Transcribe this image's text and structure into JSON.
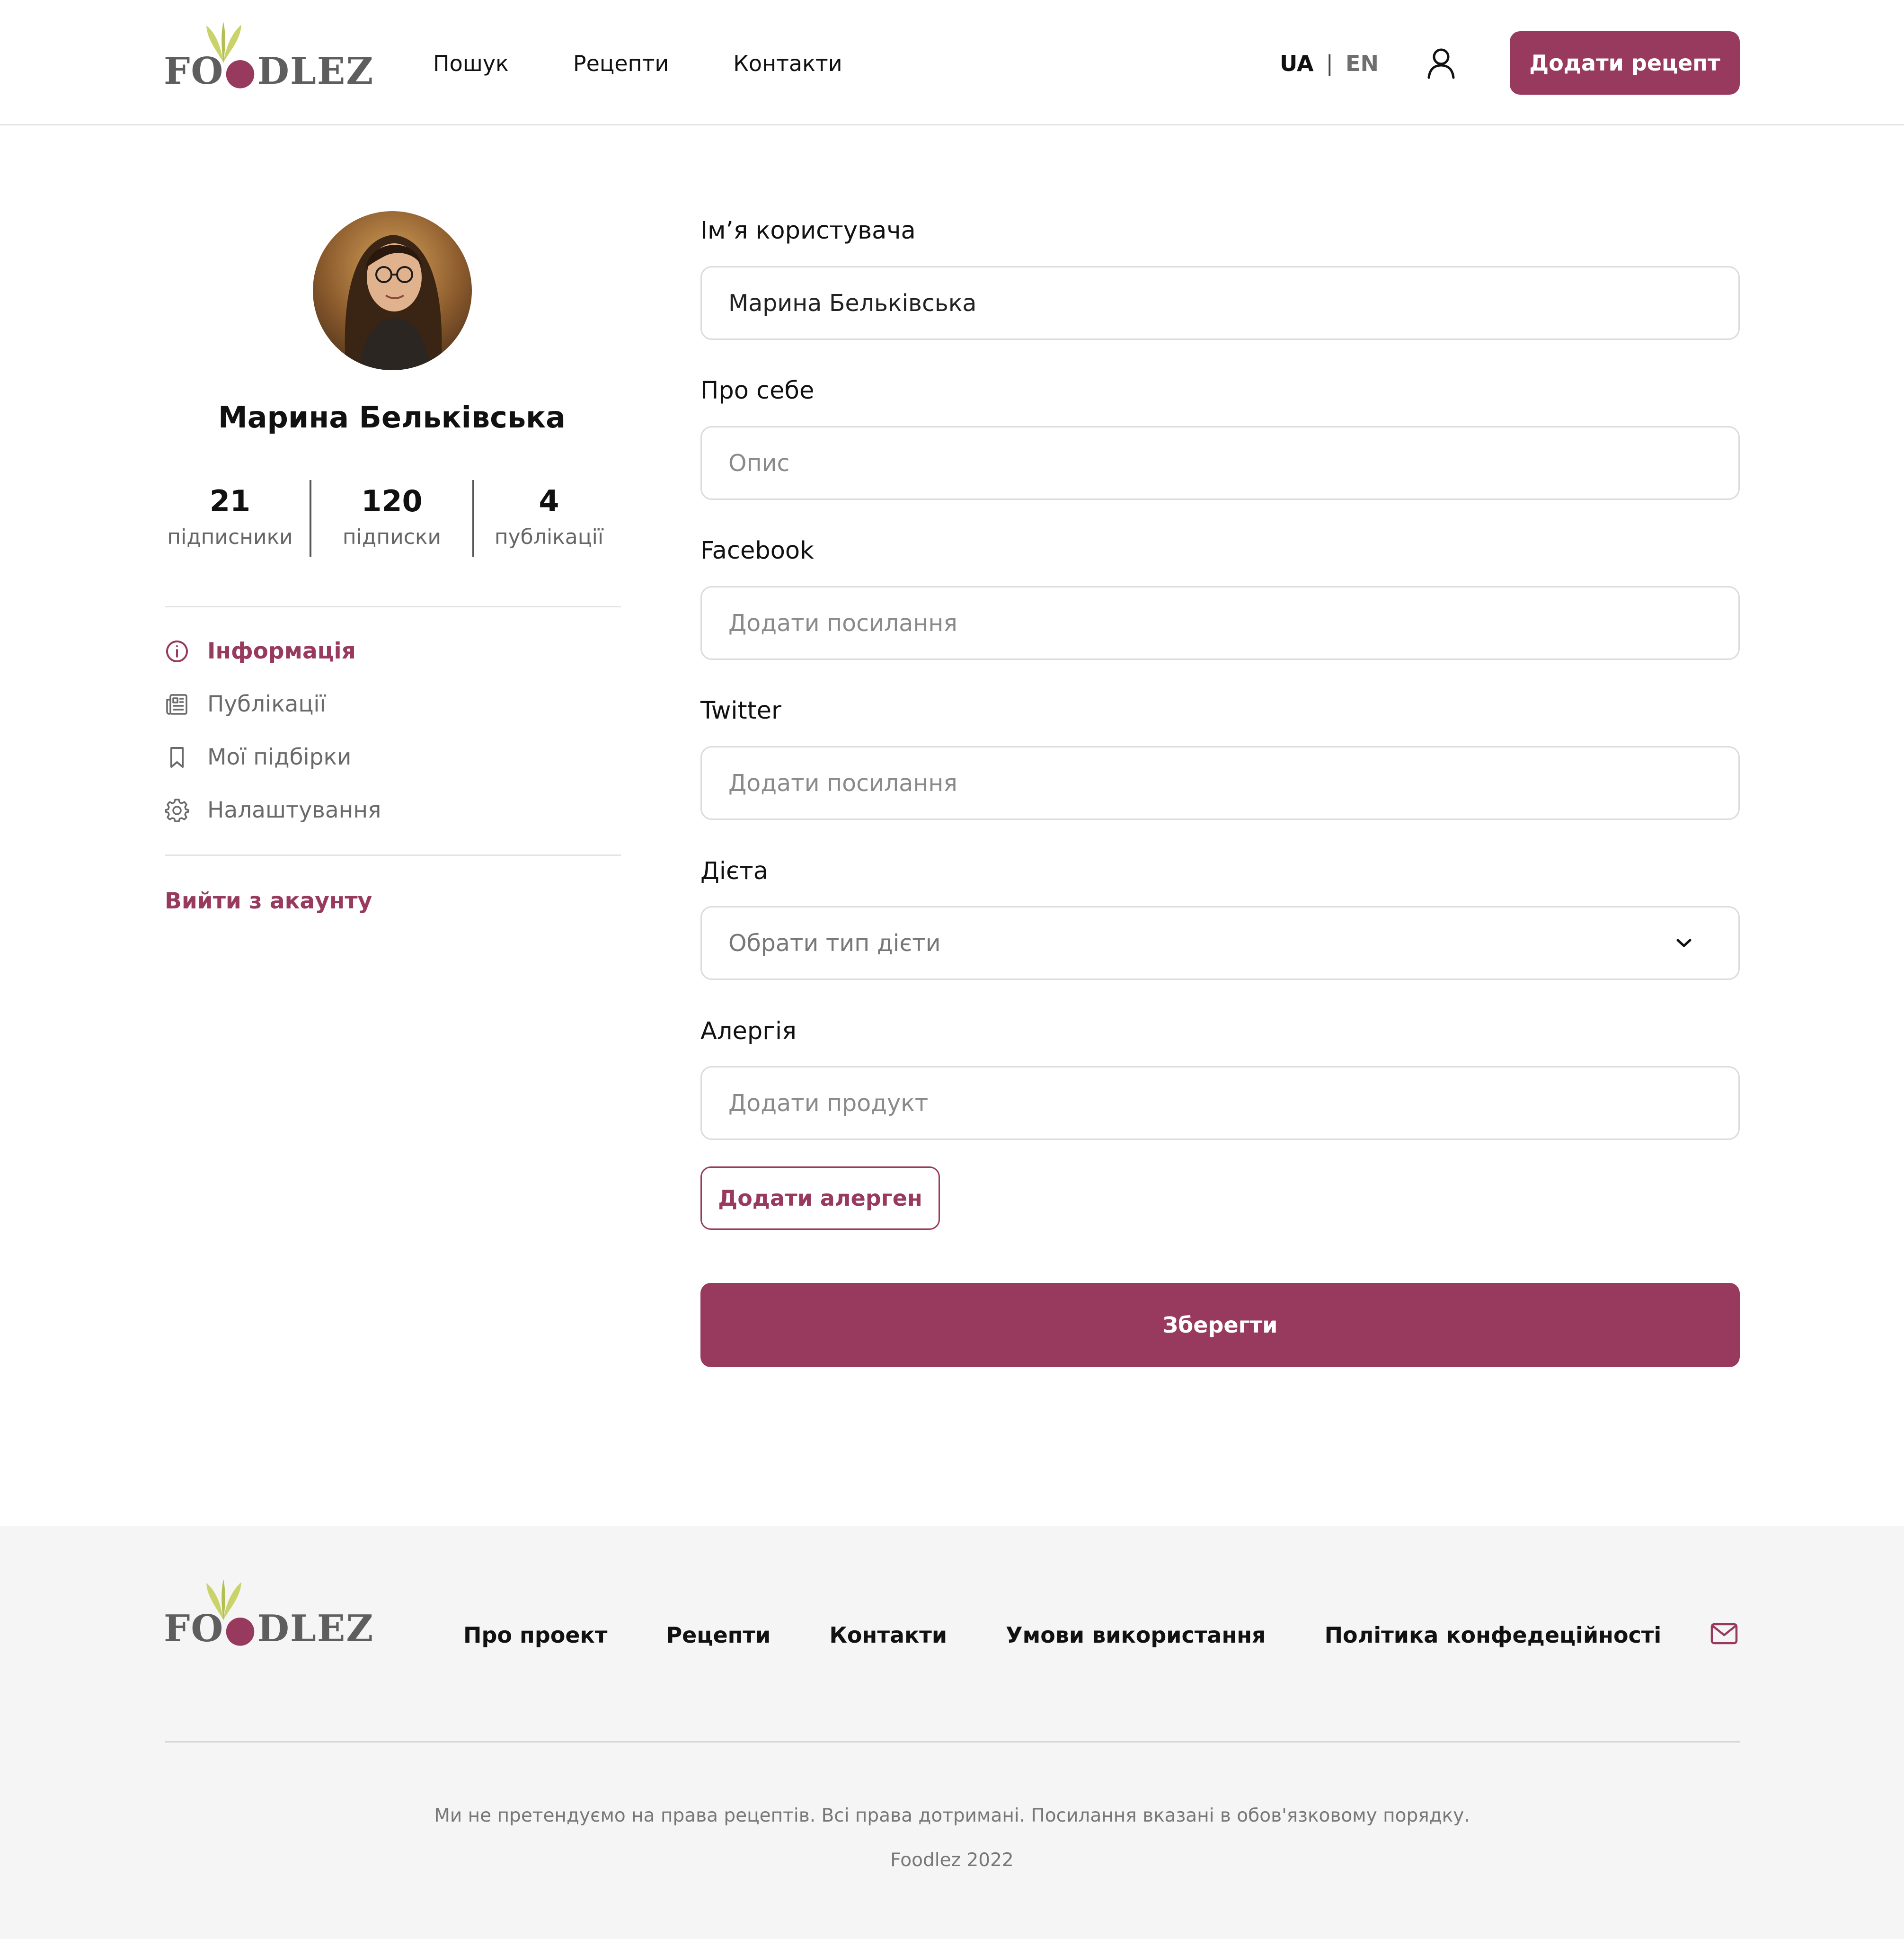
{
  "brand": {
    "name": "FOODLEZ",
    "accent": "#983a5e",
    "logo_leaf_color": "#c9d36a"
  },
  "header": {
    "nav": [
      "Пошук",
      "Рецепти",
      "Контакти"
    ],
    "lang_ua": "UA",
    "lang_sep": "|",
    "lang_en": "EN",
    "user_icon": "user-icon",
    "add_recipe": "Додати рецепт"
  },
  "profile": {
    "name": "Марина Бельківська",
    "stats": [
      {
        "value": "21",
        "label": "підписники"
      },
      {
        "value": "120",
        "label": "підписки"
      },
      {
        "value": "4",
        "label": "публікації"
      }
    ],
    "menu": [
      {
        "label": "Інформація",
        "icon": "info-icon",
        "active": true
      },
      {
        "label": "Публікації",
        "icon": "newspaper-icon",
        "active": false
      },
      {
        "label": "Мої підбірки",
        "icon": "bookmark-icon",
        "active": false
      },
      {
        "label": "Налаштування",
        "icon": "gear-icon",
        "active": false
      }
    ],
    "logout": "Вийти з акаунту"
  },
  "form": {
    "username_label": "Ім’я користувача",
    "username_value": "Марина Бельківська",
    "about_label": "Про себе",
    "about_placeholder": "Опис",
    "facebook_label": "Facebook",
    "facebook_placeholder": "Додати посилання",
    "twitter_label": "Twitter",
    "twitter_placeholder": "Додати посилання",
    "diet_label": "Дієта",
    "diet_value": "Обрати тип дієти",
    "allergy_label": "Алергія",
    "allergy_placeholder": "Додати продукт",
    "add_allergen": "Додати алерген",
    "save": "Зберегти"
  },
  "footer": {
    "nav": [
      "Про проект",
      "Рецепти",
      "Контакти",
      "Умови використання",
      "Політика конфедеційності"
    ],
    "mail_icon": "mail-icon",
    "disclaimer": "Ми не претендуємо на права рецептів. Всі права дотримані. Посилання вказані в обов'язковому порядку.",
    "copyright": "Foodlez 2022"
  }
}
